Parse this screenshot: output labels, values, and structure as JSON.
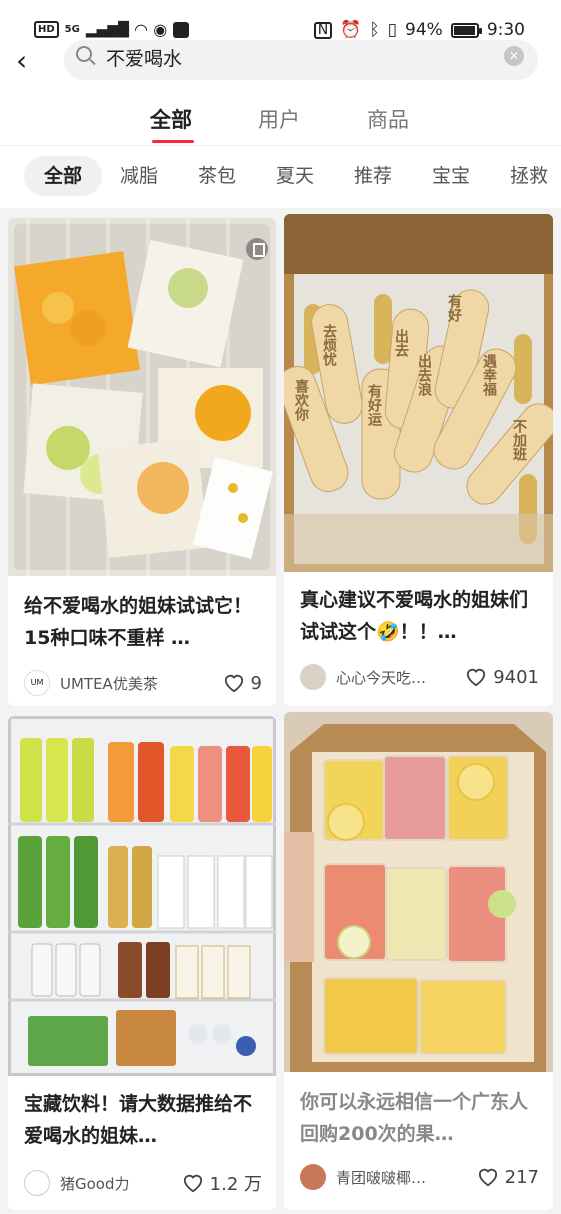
{
  "status_bar": {
    "left_badge": "HD",
    "network": "5G",
    "battery": "94%",
    "battery_level": 0.94,
    "time": "9:30"
  },
  "search": {
    "query": "不爱喝水"
  },
  "tabs": [
    {
      "label": "全部",
      "active": true
    },
    {
      "label": "用户",
      "active": false
    },
    {
      "label": "商品",
      "active": false
    }
  ],
  "filters": [
    "全部",
    "减脂",
    "茶包",
    "夏天",
    "推荐",
    "宝宝",
    "拯救"
  ],
  "posts": [
    {
      "title": "给不爱喝水的姐妹试试它！15种口味不重样 …",
      "author": "UMTEA优美茶",
      "likes": "9",
      "title_muted": false
    },
    {
      "title": "真心建议不爱喝水的姐妹们试试这个🤣！！…",
      "author": "心心今天吃…",
      "likes": "9401",
      "title_muted": false
    },
    {
      "title": "宝藏饮料！请大数据推给不爱喝水的姐妹…",
      "author": "猪Good力",
      "likes": "1.2 万",
      "title_muted": false
    },
    {
      "title": "你可以永远相信一个广东人回购200次的果…",
      "author": "青团啵啵椰…",
      "likes": "217",
      "title_muted": true
    }
  ],
  "colors": {
    "accent": "#ff2442",
    "background": "#f3f3f3"
  },
  "icons": {
    "back": "back-arrow-icon",
    "search": "search-icon",
    "clear": "clear-icon",
    "like": "heart-icon",
    "save": "bookmark-icon"
  }
}
